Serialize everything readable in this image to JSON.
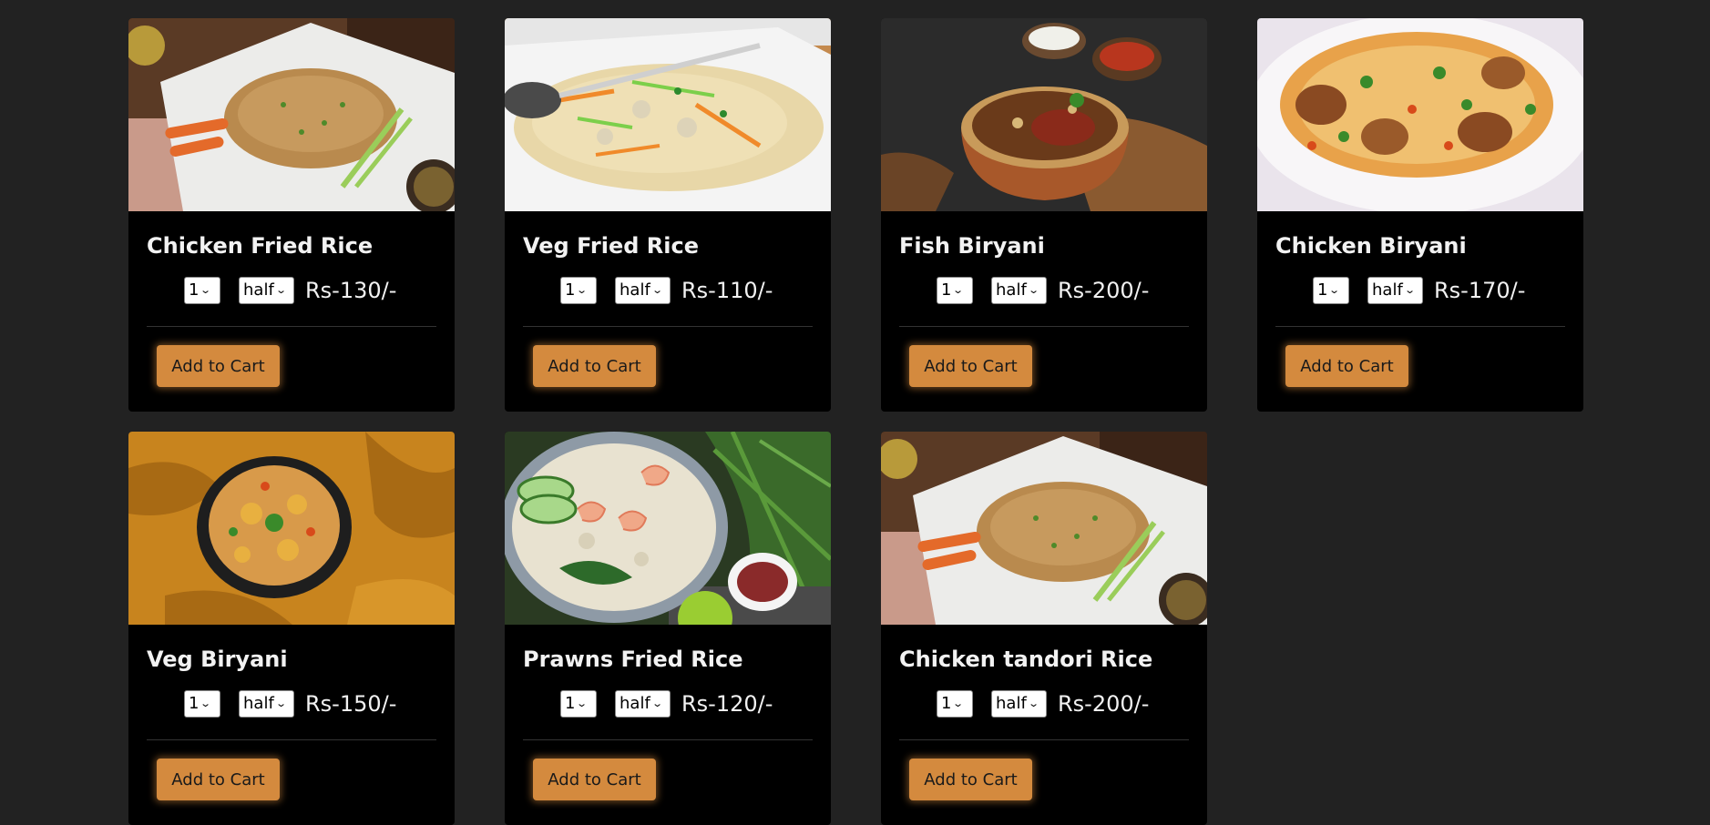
{
  "accent_color": "#d48a3e",
  "background_color": "#222222",
  "card_color": "#000000",
  "products": [
    {
      "name": "Chicken Fried Rice",
      "qty": "1",
      "portion": "half",
      "price": "Rs-130/-",
      "button": "Add to Cart",
      "image": "plate-fried-rice"
    },
    {
      "name": "Veg Fried Rice",
      "qty": "1",
      "portion": "half",
      "price": "Rs-110/-",
      "button": "Add to Cart",
      "image": "plate-veg-rice"
    },
    {
      "name": "Fish Biryani",
      "qty": "1",
      "portion": "half",
      "price": "Rs-200/-",
      "button": "Add to Cart",
      "image": "bowl-fish-biryani"
    },
    {
      "name": "Chicken Biryani",
      "qty": "1",
      "portion": "half",
      "price": "Rs-170/-",
      "button": "Add to Cart",
      "image": "plate-chicken-biryani"
    },
    {
      "name": "Veg Biryani",
      "qty": "1",
      "portion": "half",
      "price": "Rs-150/-",
      "button": "Add to Cart",
      "image": "bowl-veg-biryani"
    },
    {
      "name": "Prawns Fried Rice",
      "qty": "1",
      "portion": "half",
      "price": "Rs-120/-",
      "button": "Add to Cart",
      "image": "plate-prawn-rice"
    },
    {
      "name": "Chicken tandori Rice",
      "qty": "1",
      "portion": "half",
      "price": "Rs-200/-",
      "button": "Add to Cart",
      "image": "plate-fried-rice"
    }
  ]
}
